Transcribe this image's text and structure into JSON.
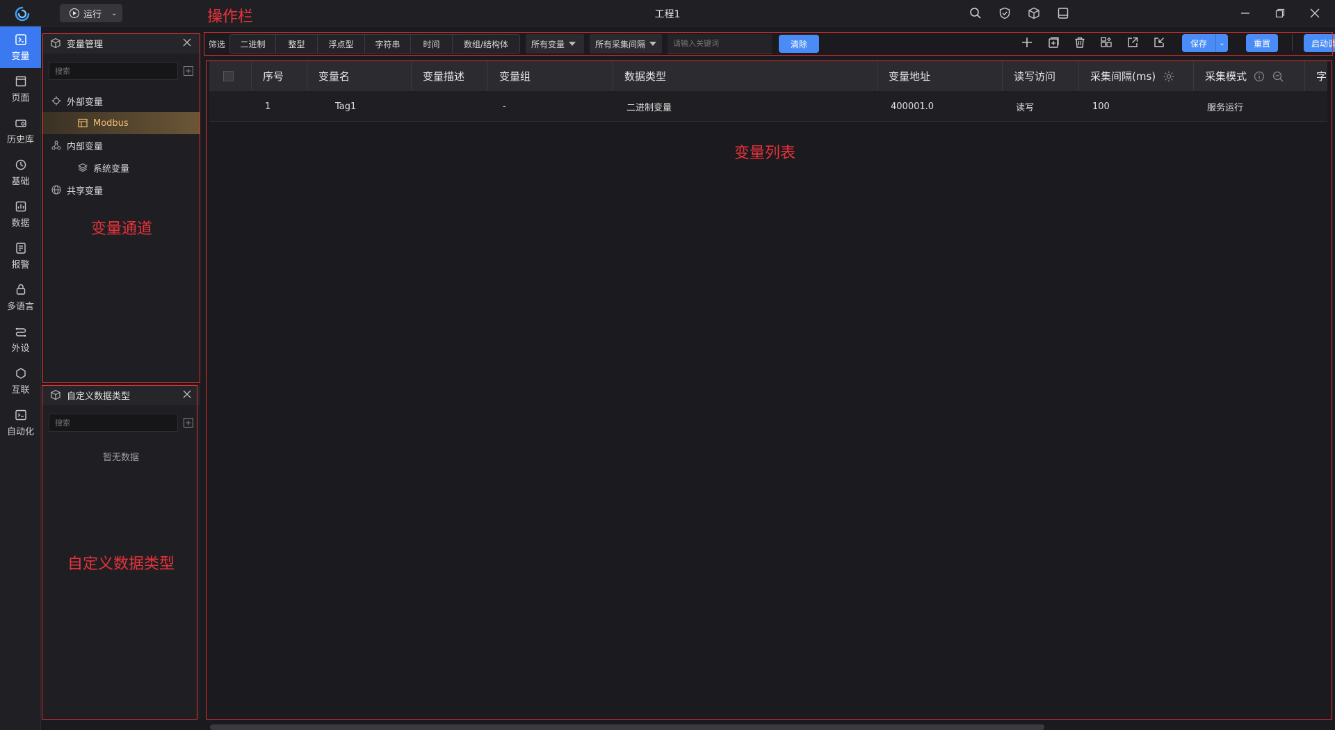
{
  "titlebar": {
    "run_label": "运行",
    "project_title": "工程1",
    "icons": [
      "search-icon",
      "shield-icon",
      "cube-icon",
      "layout-icon"
    ],
    "window_controls": [
      "minimize-icon",
      "restore-icon",
      "close-icon"
    ]
  },
  "annotations": {
    "toolbar": "操作栏",
    "channels": "变量通道",
    "list": "变量列表",
    "custom_types": "自定义数据类型"
  },
  "nav": {
    "items": [
      {
        "label": "变量",
        "icon": "variable-icon",
        "active": true
      },
      {
        "label": "页面",
        "icon": "page-icon"
      },
      {
        "label": "历史库",
        "icon": "history-icon"
      },
      {
        "label": "基础",
        "icon": "basic-icon"
      },
      {
        "label": "数据",
        "icon": "data-icon"
      },
      {
        "label": "报警",
        "icon": "alarm-icon"
      },
      {
        "label": "多语言",
        "icon": "language-icon"
      },
      {
        "label": "外设",
        "icon": "peripheral-icon"
      },
      {
        "label": "互联",
        "icon": "connect-icon"
      },
      {
        "label": "自动化",
        "icon": "automation-icon"
      }
    ]
  },
  "var_manager": {
    "title": "变量管理",
    "search_placeholder": "搜索",
    "tree": {
      "external": "外部变量",
      "modbus": "Modbus",
      "internal": "内部变量",
      "system": "系统变量",
      "shared": "共享变量"
    }
  },
  "custom_types": {
    "title": "自定义数据类型",
    "search_placeholder": "搜索",
    "empty": "暂无数据"
  },
  "toolbar": {
    "filter_label": "筛选",
    "filters": [
      "二进制",
      "整型",
      "浮点型",
      "字符串",
      "时间",
      "数组/结构体"
    ],
    "all_vars": "所有变量",
    "all_intervals": "所有采集间隔",
    "keyword_placeholder": "请输入关键词",
    "clear": "清除",
    "save": "保存",
    "reset": "重置",
    "start_debug": "启动调试",
    "icons": [
      "add-icon",
      "add-group-icon",
      "delete-icon",
      "batch-icon",
      "export-icon",
      "import-icon"
    ]
  },
  "table": {
    "headers": {
      "index": "序号",
      "name": "变量名",
      "desc": "变量描述",
      "group": "变量组",
      "type": "数据类型",
      "address": "变量地址",
      "access": "读写访问",
      "interval": "采集间隔(ms)",
      "mode": "采集模式",
      "extra": "字"
    },
    "rows": [
      {
        "index": "1",
        "name": "Tag1",
        "desc": "",
        "group": "-",
        "type": "二进制变量",
        "address": "400001.0",
        "access": "读写",
        "interval": "100",
        "mode": "服务运行"
      }
    ]
  }
}
